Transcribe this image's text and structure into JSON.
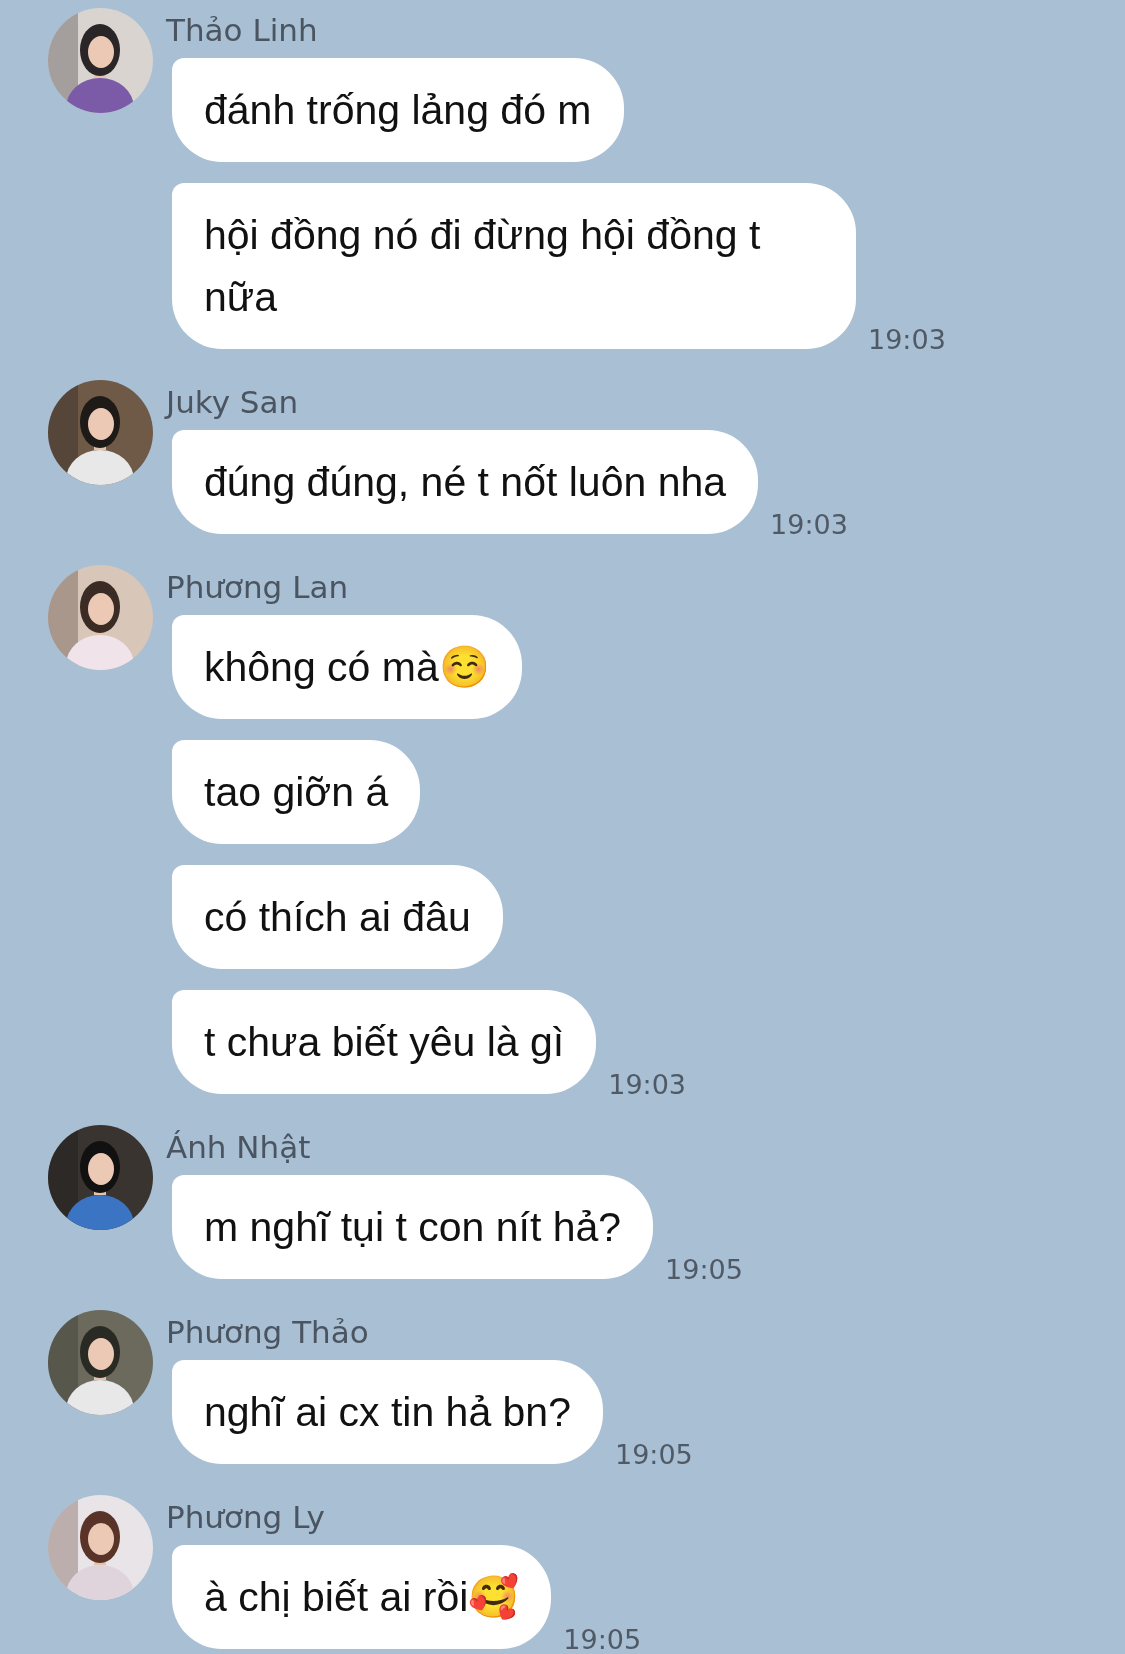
{
  "groups": [
    {
      "sender": "Thảo Linh",
      "messages": [
        {
          "text": "đánh trống lảng đó m"
        },
        {
          "text": "hội đồng nó đi đừng hội đồng t nữa",
          "time": "19:03"
        }
      ]
    },
    {
      "sender": "Juky San",
      "messages": [
        {
          "text": "đúng đúng, né t nốt luôn nha",
          "time": "19:03"
        }
      ]
    },
    {
      "sender": "Phương Lan",
      "messages": [
        {
          "text": "không có mà☺️"
        },
        {
          "text": "tao giỡn á"
        },
        {
          "text": "có thích ai đâu"
        },
        {
          "text": "t chưa biết yêu là gì",
          "time": "19:03"
        }
      ]
    },
    {
      "sender": "Ánh Nhật",
      "messages": [
        {
          "text": "m nghĩ tụi t con nít hả?",
          "time": "19:05"
        }
      ]
    },
    {
      "sender": "Phương Thảo",
      "messages": [
        {
          "text": "nghĩ ai cx tin hả bn?",
          "time": "19:05"
        }
      ]
    },
    {
      "sender": "Phương Ly",
      "messages": [
        {
          "text": "à chị biết ai rồi🥰",
          "time": "19:05"
        }
      ]
    }
  ]
}
